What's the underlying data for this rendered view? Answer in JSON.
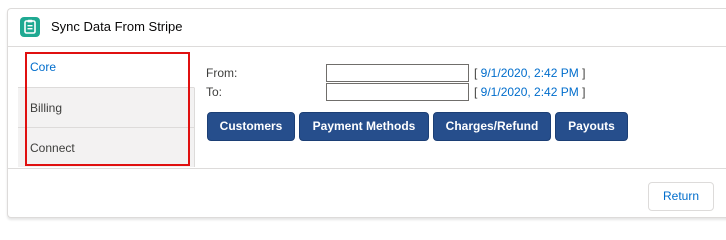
{
  "header": {
    "title": "Sync Data From Stripe",
    "icon": "clipboard-icon",
    "icon_color": "#1fa992"
  },
  "tabs": [
    {
      "label": "Core",
      "active": true
    },
    {
      "label": "Billing",
      "active": false
    },
    {
      "label": "Connect",
      "active": false
    }
  ],
  "form": {
    "from_label": "From:",
    "from_value": "",
    "from_date_prefix": "[ ",
    "from_date": "9/1/2020, 2:42 PM",
    "from_date_suffix": " ]",
    "to_label": "To:",
    "to_value": "",
    "to_date_prefix": "[ ",
    "to_date": "9/1/2020, 2:42 PM",
    "to_date_suffix": " ]"
  },
  "buttons": {
    "customers": "Customers",
    "payment_methods": "Payment Methods",
    "charges_refund": "Charges/Refund",
    "payouts": "Payouts"
  },
  "footer": {
    "return_label": "Return"
  },
  "colors": {
    "brand_button": "#264e8c",
    "link": "#006dcc",
    "highlight_outline": "#e01010"
  }
}
